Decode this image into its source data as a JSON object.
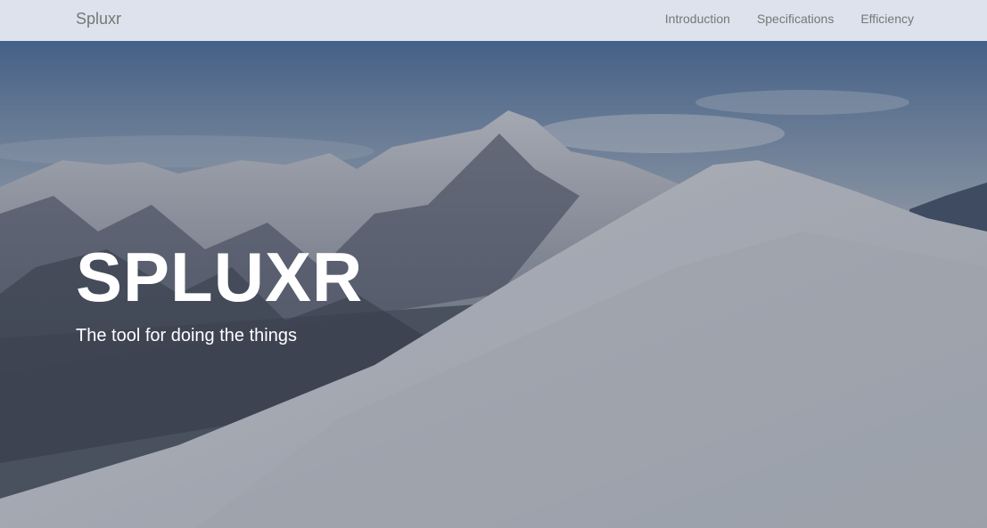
{
  "navbar": {
    "brand": "Spluxr",
    "links": [
      {
        "label": "Introduction"
      },
      {
        "label": "Specifications"
      },
      {
        "label": "Efficiency"
      }
    ]
  },
  "hero": {
    "title": "SPLUXR",
    "tagline": "The tool for doing the things"
  },
  "colors": {
    "navbar_bg": "#e4e8f0",
    "nav_text": "#777777",
    "hero_text": "#ffffff",
    "sky": "#4a6fa3"
  }
}
